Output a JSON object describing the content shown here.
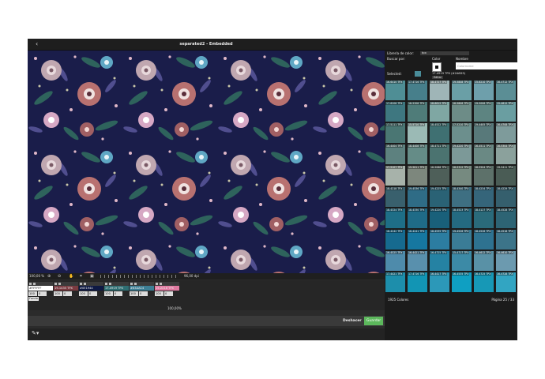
{
  "window": {
    "title": "separated2 - Embedded",
    "back_icon": "‹"
  },
  "statusbar": {
    "zoom": "100,00 %",
    "dpi": "96,00 dpi"
  },
  "swatches": [
    {
      "name": "#FFFFFF",
      "color": "#ffffff",
      "v1": "100",
      "v2": "0",
      "label": "Fondo"
    },
    {
      "name": "19-1435 TPX",
      "color": "#7a3a40",
      "v1": "100",
      "v2": "0"
    },
    {
      "name": "#0E1944",
      "color": "#0e1944",
      "v1": "100",
      "v2": "0"
    },
    {
      "name": "17-4919 TPX",
      "color": "#2f6f73",
      "v1": "100",
      "v2": "0"
    },
    {
      "name": "#63AAC4",
      "color": "#63aac4",
      "v1": "100",
      "v2": "0"
    },
    {
      "name": "15-2216 TPX",
      "color": "#e07aa1",
      "v1": "100",
      "v2": "0"
    }
  ],
  "percent": "100,00%",
  "buttons": {
    "undo": "Deshacer",
    "save": "Guardar"
  },
  "library": {
    "label": "Librería de color:",
    "select": "tpx",
    "search_label": "Buscar por:",
    "col_color": "Color",
    "col_name": "Nombre",
    "name_placeholder": "Colorname",
    "selected_label": "Selected:",
    "selected_code": "17-4919 TPX (#2A6D3)",
    "edit_label": "Editar",
    "footer_count": "1925 Colores",
    "footer_page_label": "Página",
    "footer_page": "25 / 33",
    "cells": [
      {
        "code": "16-6410 TPX",
        "color": "#4f8e95"
      },
      {
        "code": "17-4716 TPX",
        "color": "#477f8b"
      },
      {
        "code": "18-4727 TPX",
        "color": "#9fb5b7"
      },
      {
        "code": "19-5808 TPX",
        "color": "#6a9fa6"
      },
      {
        "code": "15-6210 TPX",
        "color": "#6e9fab"
      },
      {
        "code": "16-4712 TPX",
        "color": "#5b8e95"
      },
      {
        "code": "17-6208 TPX",
        "color": "#3e7780"
      },
      {
        "code": "18-5308 TPX",
        "color": "#4f7c79"
      },
      {
        "code": "18-6612 TPX",
        "color": "#7fa7a3"
      },
      {
        "code": "16-5806 TPX",
        "color": "#6d8c87"
      },
      {
        "code": "19-5006 TPX",
        "color": "#5d8481"
      },
      {
        "code": "15-4612 TPX",
        "color": "#6a9ea1"
      },
      {
        "code": "17-5111 TPX",
        "color": "#4a7673"
      },
      {
        "code": "15-5710 TPX",
        "color": "#9bbab5"
      },
      {
        "code": "18-4522 TPX",
        "color": "#3f7072"
      },
      {
        "code": "17-5210 TPX",
        "color": "#6c8f8d"
      },
      {
        "code": "19-4405 TPX",
        "color": "#58797a"
      },
      {
        "code": "16-4708 TPX",
        "color": "#7e9b9b"
      },
      {
        "code": "16-4404 TPX",
        "color": "#5d817f"
      },
      {
        "code": "18-4408 TPX",
        "color": "#658c87"
      },
      {
        "code": "18-4711 TPX",
        "color": "#4b7370"
      },
      {
        "code": "19-4220 TPX",
        "color": "#7c9998"
      },
      {
        "code": "16-4511 TPX",
        "color": "#6a8984"
      },
      {
        "code": "16-5304 TPX",
        "color": "#8ba19c"
      },
      {
        "code": "17-5107 TPX",
        "color": "#a7b2aa"
      },
      {
        "code": "19-5611 TPX",
        "color": "#7d877d"
      },
      {
        "code": "16-5088 TPX",
        "color": "#4e5f59"
      },
      {
        "code": "16-5312 TPX",
        "color": "#768a80"
      },
      {
        "code": "18-5504 TPX",
        "color": "#5d716a"
      },
      {
        "code": "19-5411 TPX",
        "color": "#4a5c55"
      },
      {
        "code": "18-4218 TPX",
        "color": "#39606d"
      },
      {
        "code": "19-4536 TPX",
        "color": "#2f6c86"
      },
      {
        "code": "19-4225 TPX",
        "color": "#2a6275"
      },
      {
        "code": "18-4340 TPX",
        "color": "#3e6f82"
      },
      {
        "code": "18-4234 TPX",
        "color": "#35657a"
      },
      {
        "code": "18-4229 TPX",
        "color": "#355f6d"
      },
      {
        "code": "18-4324 TPX",
        "color": "#1e6e87"
      },
      {
        "code": "18-4330 TPX",
        "color": "#1f6b87"
      },
      {
        "code": "19-4220 TPX",
        "color": "#19607a"
      },
      {
        "code": "18-4523 TPX",
        "color": "#246a81"
      },
      {
        "code": "18-4127 TPX",
        "color": "#2a6a7a"
      },
      {
        "code": "18-4528 TPX",
        "color": "#2d6474"
      },
      {
        "code": "18-4242 TPX",
        "color": "#166a8f"
      },
      {
        "code": "16-4241 TPX",
        "color": "#1677a0"
      },
      {
        "code": "18-4535 TPX",
        "color": "#2c7da1"
      },
      {
        "code": "19-4526 TPX",
        "color": "#3a7c96"
      },
      {
        "code": "18-4526 TPX",
        "color": "#2e7290"
      },
      {
        "code": "18-4518 TPX",
        "color": "#3c7489"
      },
      {
        "code": "16-4525 TPX",
        "color": "#4e8bab"
      },
      {
        "code": "16-4421 TPX",
        "color": "#5990ad"
      },
      {
        "code": "16-4725 TPX",
        "color": "#2582a3"
      },
      {
        "code": "15-4717 TPX",
        "color": "#3c8aa6"
      },
      {
        "code": "16-4612 TPX",
        "color": "#5991a6"
      },
      {
        "code": "16-4610 TPX",
        "color": "#6c9aaf"
      },
      {
        "code": "17-4421 TPX",
        "color": "#1d8eab"
      },
      {
        "code": "17-4716 TPX",
        "color": "#1295b4"
      },
      {
        "code": "16-4417 TPX",
        "color": "#2c98b8"
      },
      {
        "code": "16-4535 TPX",
        "color": "#0f9fc2"
      },
      {
        "code": "16-4725 TPX",
        "color": "#1798b6"
      },
      {
        "code": "16-4728 TPX",
        "color": "#32a5c2"
      }
    ]
  }
}
